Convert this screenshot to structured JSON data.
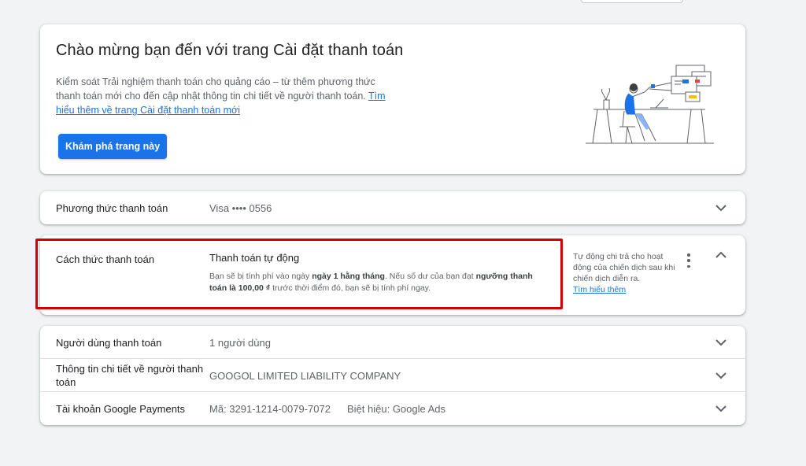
{
  "welcome": {
    "title": "Chào mừng bạn đến với trang Cài đặt thanh toán",
    "description": "Kiểm soát Trải nghiệm thanh toán cho quảng cáo – từ thêm phương thức thanh toán mới cho đến cập nhật thông tin chi tiết về người thanh toán.",
    "learn_more_link": "Tìm hiểu thêm về trang Cài đặt thanh toán mới",
    "explore_button": "Khám phá trang này"
  },
  "payment_method": {
    "label": "Phương thức thanh toán",
    "value": "Visa •••• 0556"
  },
  "payment_way": {
    "label": "Cách thức thanh toán",
    "value_title": "Thanh toán tự động",
    "detail_part1": "Bạn sẽ bị tính phí vào ngày ",
    "detail_bold1": "ngày 1 hằng tháng",
    "detail_part2": ". Nếu số dư của bạn đạt ",
    "detail_bold2": "ngưỡng thanh toán là 100,00 ₫",
    "detail_part3": " trước thời điểm đó, bạn sẽ bị tính phí ngay.",
    "side_note": "Tự động chi trả cho hoạt động của chiến dịch sau khi chiến dịch diễn ra.",
    "side_link": "Tìm hiểu thêm"
  },
  "rows": {
    "users_label": "Người dùng thanh toán",
    "users_value": "1 người dùng",
    "payer_label": "Thông tin chi tiết về người thanh toán",
    "payer_value": "GOOGOL LIMITED LIABILITY COMPANY",
    "gpay_label": "Tài khoản Google Payments",
    "gpay_id": "Mã: 3291-1214-0079-7072",
    "gpay_nickname": "Biệt hiệu: Google Ads"
  },
  "icons": {
    "expand": "chevron-down-icon",
    "collapse": "chevron-up-icon",
    "more": "more-vert-icon"
  },
  "colors": {
    "accent": "#1a73e8",
    "highlight": "#d50000",
    "background": "#f1f3f4"
  }
}
